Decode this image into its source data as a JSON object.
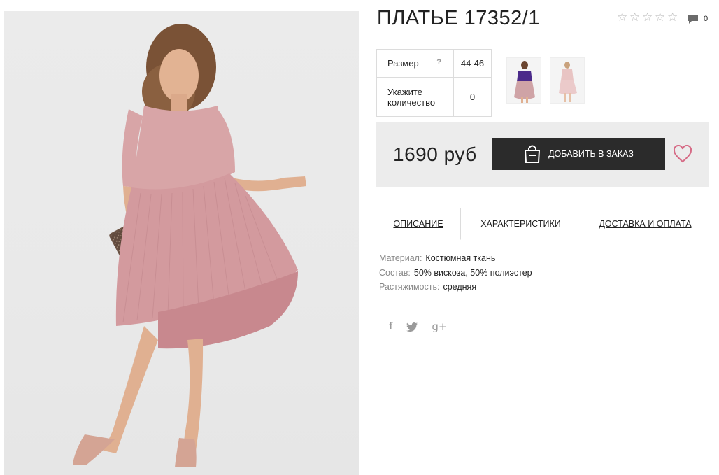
{
  "product": {
    "title": "ПЛАТЬЕ 17352/1",
    "rating_stars": 5,
    "comment_count": "0"
  },
  "options": {
    "size_label": "Размер",
    "size_help": "?",
    "size_value": "44-46",
    "qty_label_line1": "Укажите",
    "qty_label_line2": "количество",
    "qty_value": "0"
  },
  "purchase": {
    "price": "1690 руб",
    "add_button_label": "ДОБАВИТЬ В ЗАКАЗ"
  },
  "tabs": {
    "description": "ОПИСАНИЕ",
    "characteristics": "ХАРАКТЕРИСТИКИ",
    "delivery": "ДОСТАВКА И ОПЛАТА"
  },
  "characteristics": [
    {
      "key": "Материал:",
      "value": "Костюмная ткань"
    },
    {
      "key": "Состав:",
      "value": "50% вискоза, 50% полиэстер"
    },
    {
      "key": "Растяжимость:",
      "value": "средняя"
    }
  ],
  "social": {
    "facebook": "f",
    "twitter": "🐦",
    "googleplus": "g+"
  },
  "colors": {
    "button_bg": "#2b2b2b",
    "heart": "#d66b86",
    "dress_pink": "#d8a5a7",
    "price_box_bg": "#ececec"
  },
  "icons": [
    "star-icon",
    "comment-icon",
    "help-icon",
    "bag-icon",
    "heart-icon",
    "facebook-icon",
    "twitter-icon",
    "googleplus-icon"
  ]
}
